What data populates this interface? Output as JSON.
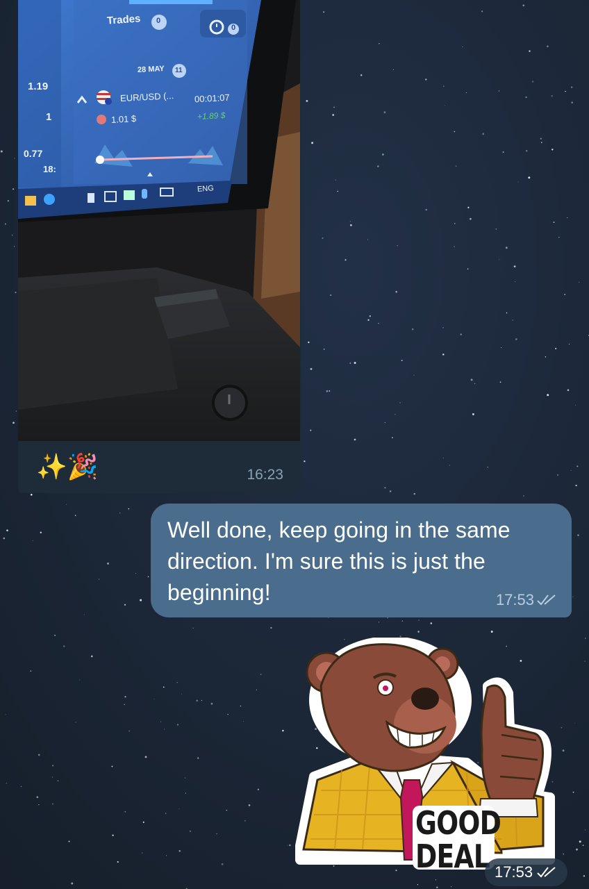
{
  "photo_message": {
    "screen": {
      "panel_title": "Trades",
      "trades_count": "0",
      "clock_count": "0",
      "date": "28 MAY",
      "date_badge": "11",
      "price_high": "1.19",
      "price_mid": "1",
      "price_low": "0.77",
      "price_label_cut": "18:",
      "pair": "EUR/USD (...",
      "timer": "00:01:07",
      "amount": "1.01 $",
      "profit": "+1.89 $",
      "taskbar_lang": "ENG"
    },
    "caption_emoji": "✨🎉",
    "time": "16:23"
  },
  "reply_message": {
    "text": "Well done, keep going in the same direction. I'm sure this is just the beginning!",
    "time": "17:53",
    "status_icon": "double-check-icon"
  },
  "sticker_message": {
    "sticker_text_line1": "GOOD",
    "sticker_text_line2": "DEAL",
    "time": "17:53",
    "status_icon": "double-check-icon"
  },
  "colors": {
    "background": "#1b2533",
    "incoming_bubble": "#1e2c3a",
    "outgoing_bubble": "#4b6d8d",
    "profit_green": "#5fd46a"
  }
}
